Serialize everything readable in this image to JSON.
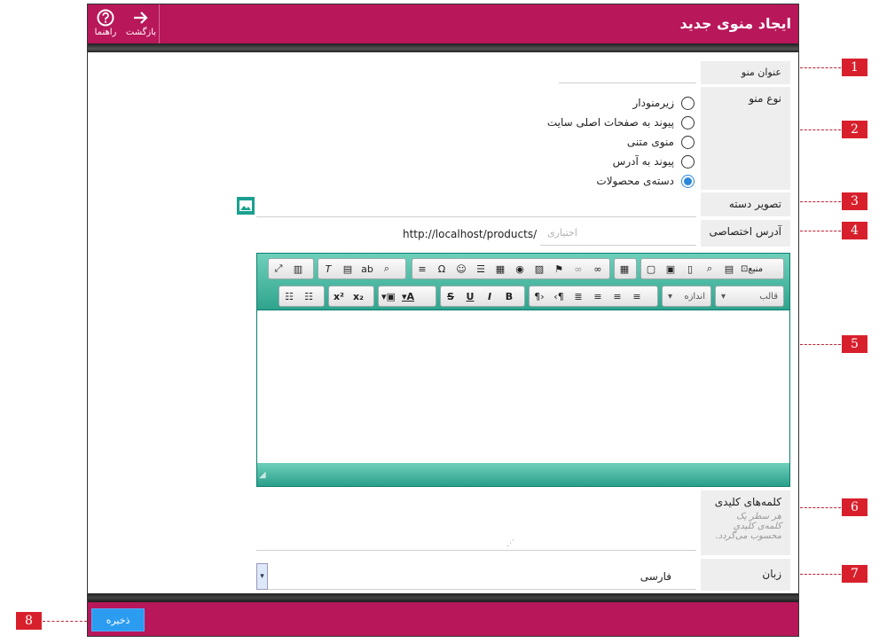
{
  "header": {
    "title": "ایجاد منوی جدید",
    "help_label": "راهنما",
    "back_label": "بازگشت"
  },
  "form": {
    "title_label": "عنوان منو",
    "type_label": "نوع منو",
    "type_options": [
      {
        "label": "زیرمنودار",
        "selected": false
      },
      {
        "label": "پیوند به صفحات اصلی سایت",
        "selected": false
      },
      {
        "label": "منوی متنی",
        "selected": false
      },
      {
        "label": "پیوند به آدرس",
        "selected": false
      },
      {
        "label": "دسته‌ی محصولات",
        "selected": true
      }
    ],
    "image_label": "تصویر دسته",
    "custom_url_label": "آدرس اختصاصی",
    "url_prefix": "http://localhost/products/",
    "url_placeholder": "اختیاری",
    "keywords_label": "کلمه‌های کلیدی",
    "keywords_hint": "هر سطر یک کلمه‌ی کلیدی محسوب می‌گردد.",
    "language_label": "زبان",
    "language_value": "فارسی"
  },
  "editor": {
    "source_label": "منبع",
    "format_label": "قالب",
    "size_label": "اندازه",
    "bold": "B",
    "italic": "I",
    "underline": "U",
    "strike": "S",
    "superscript": "x²",
    "subscript": "x₂",
    "text_color": "A"
  },
  "footer": {
    "save_label": "ذخیره"
  },
  "callouts": [
    "1",
    "2",
    "3",
    "4",
    "5",
    "6",
    "7",
    "8"
  ],
  "colors": {
    "brand": "#b8175a",
    "editor_accent": "#2fa48d",
    "save_button": "#2b9cf0",
    "callout": "#d8202c"
  }
}
